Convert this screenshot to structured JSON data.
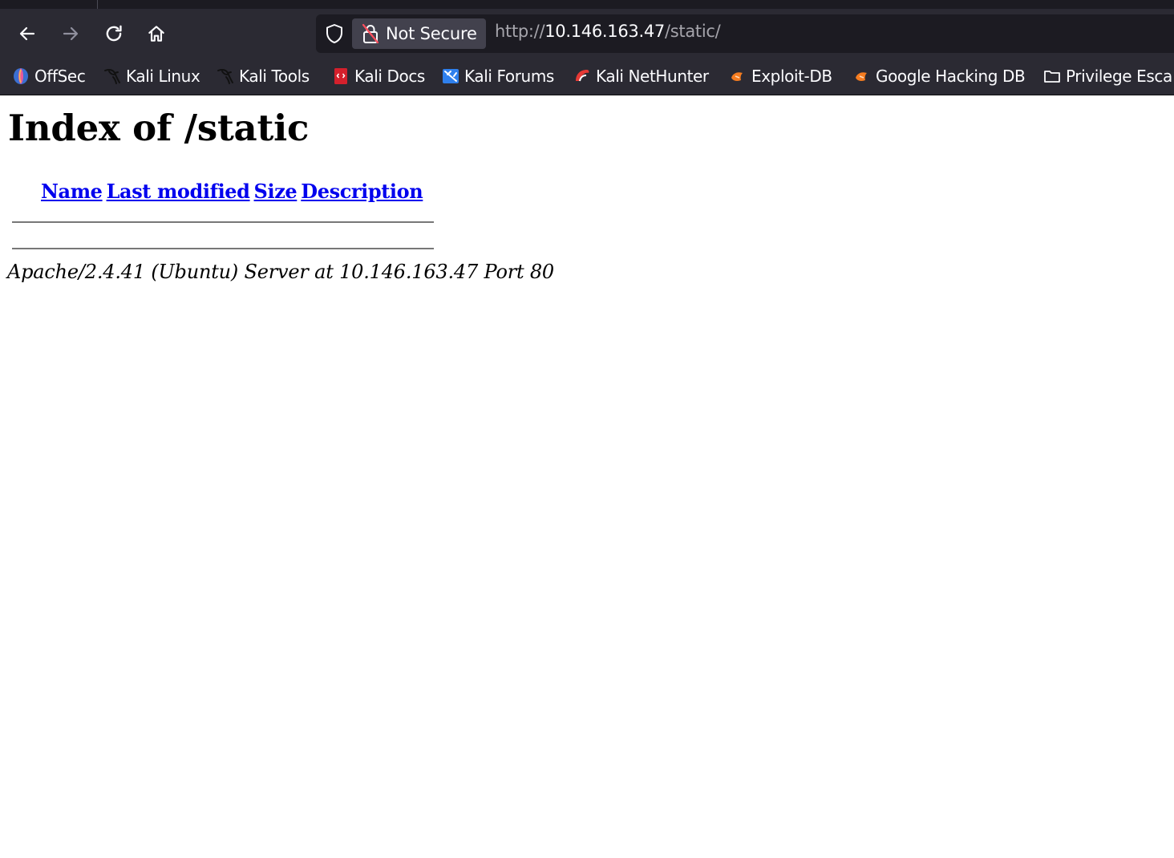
{
  "browser": {
    "security_label": "Not Secure",
    "url": {
      "scheme": "http://",
      "host": "10.146.163.47",
      "path": "/static/"
    },
    "nav_icons": [
      "back-arrow-icon",
      "forward-arrow-icon",
      "reload-icon",
      "home-icon"
    ]
  },
  "bookmarks": [
    {
      "label": "OffSec",
      "icon": "offsec-icon"
    },
    {
      "label": "Kali Linux",
      "icon": "kali-dragon-icon"
    },
    {
      "label": "Kali Tools",
      "icon": "kali-dragon-icon"
    },
    {
      "label": "Kali Docs",
      "icon": "kali-docs-icon"
    },
    {
      "label": "Kali Forums",
      "icon": "kali-forums-icon"
    },
    {
      "label": "Kali NetHunter",
      "icon": "nethunter-icon"
    },
    {
      "label": "Exploit-DB",
      "icon": "exploit-db-icon"
    },
    {
      "label": "Google Hacking DB",
      "icon": "exploit-db-icon"
    },
    {
      "label": "Privilege Esca",
      "icon": "folder-icon"
    }
  ],
  "page": {
    "title": "Index of /static",
    "columns": [
      "Name",
      "Last modified",
      "Size",
      "Description"
    ],
    "footer": "Apache/2.4.41 (Ubuntu) Server at 10.146.163.47 Port 80"
  },
  "colors": {
    "chrome_bg": "#2b2a33",
    "urlbar_bg": "#1c1b22",
    "link": "#0000ee",
    "text_light": "#fbfbfe"
  }
}
